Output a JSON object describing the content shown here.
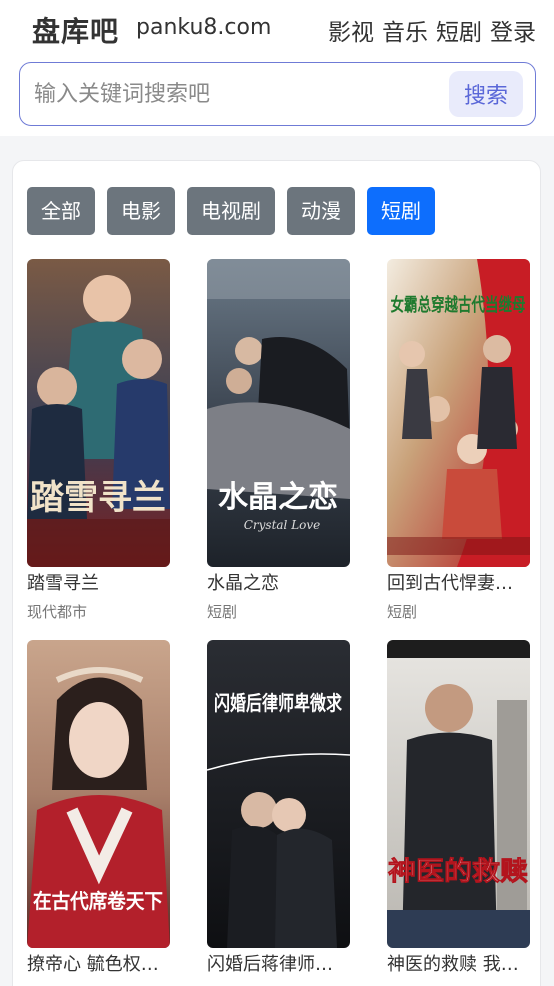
{
  "header": {
    "logo": "盘库吧",
    "domain": "panku8.com",
    "nav": [
      "影视",
      "音乐",
      "短剧",
      "登录"
    ]
  },
  "search": {
    "placeholder": "输入关键词搜索吧",
    "button": "搜索"
  },
  "tabs": [
    {
      "label": "全部",
      "active": false
    },
    {
      "label": "电影",
      "active": false
    },
    {
      "label": "电视剧",
      "active": false
    },
    {
      "label": "动漫",
      "active": false
    },
    {
      "label": "短剧",
      "active": true
    }
  ],
  "items": [
    {
      "title": "踏雪寻兰",
      "category": "现代都市",
      "poster_text": "踏雪寻兰"
    },
    {
      "title": "水晶之恋",
      "category": "短剧",
      "poster_text": "水晶之恋",
      "poster_sub": "Crystal Love"
    },
    {
      "title": "回到古代悍妻…",
      "category": "短剧",
      "poster_text": "女霸总穿越古代当继母"
    },
    {
      "title": "撩帝心 毓色权…",
      "category": "",
      "poster_text": "在古代席卷天下"
    },
    {
      "title": "闪婚后蒋律师…",
      "category": "",
      "poster_text": "闪婚后律师卑微求"
    },
    {
      "title": "神医的救赎 我…",
      "category": "",
      "poster_text": "神医的救赎"
    }
  ],
  "colors": {
    "tab_default": "#6c757d",
    "tab_active": "#0d6efd",
    "search_border": "#6f7bd6",
    "search_button_bg": "#e9ebfb",
    "search_button_text": "#5a67d8"
  }
}
